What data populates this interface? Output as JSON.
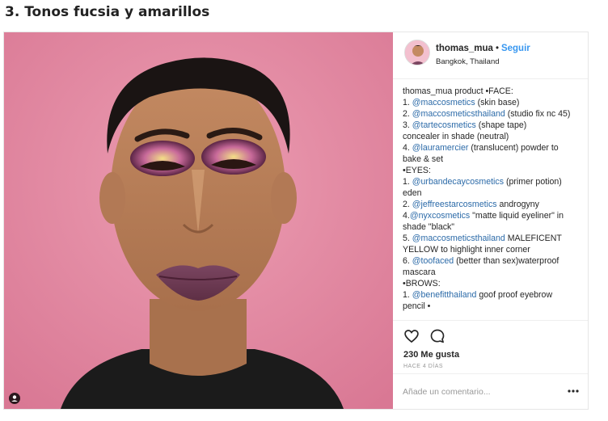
{
  "article": {
    "heading": "3. Tonos fucsia y amarillos"
  },
  "post": {
    "username": "thomas_mua",
    "separator": "•",
    "follow_label": "Seguir",
    "location": "Bangkok, Thailand",
    "caption_lines": [
      [
        {
          "t": "thomas_mua",
          "k": "user"
        },
        {
          "t": " product •FACE:",
          "k": "text"
        }
      ],
      [
        {
          "t": "1. ",
          "k": "text"
        },
        {
          "t": "@maccosmetics",
          "k": "handle"
        },
        {
          "t": " (skin base)",
          "k": "text"
        }
      ],
      [
        {
          "t": "2. ",
          "k": "text"
        },
        {
          "t": "@maccosmeticsthailand",
          "k": "handle"
        },
        {
          "t": " (studio fix nc 45)",
          "k": "text"
        }
      ],
      [
        {
          "t": "3. ",
          "k": "text"
        },
        {
          "t": "@tartecosmetics",
          "k": "handle"
        },
        {
          "t": " (shape tape)",
          "k": "text"
        }
      ],
      [
        {
          "t": "concealer in shade (neutral)",
          "k": "text"
        }
      ],
      [
        {
          "t": "4. ",
          "k": "text"
        },
        {
          "t": "@lauramercier",
          "k": "handle"
        },
        {
          "t": " (translucent) powder to",
          "k": "text"
        }
      ],
      [
        {
          "t": "bake & set",
          "k": "text"
        }
      ],
      [
        {
          "t": "•EYES:",
          "k": "text"
        }
      ],
      [
        {
          "t": "1. ",
          "k": "text"
        },
        {
          "t": "@urbandecaycosmetics",
          "k": "handle"
        },
        {
          "t": " (primer potion)",
          "k": "text"
        }
      ],
      [
        {
          "t": "eden",
          "k": "text"
        }
      ],
      [
        {
          "t": "2. ",
          "k": "text"
        },
        {
          "t": "@jeffreestarcosmetics",
          "k": "handle"
        },
        {
          "t": " androgyny",
          "k": "text"
        }
      ],
      [
        {
          "t": "4.",
          "k": "text"
        },
        {
          "t": "@nyxcosmetics",
          "k": "handle"
        },
        {
          "t": " \"matte liquid eyeliner\" in",
          "k": "text"
        }
      ],
      [
        {
          "t": "shade \"black\"",
          "k": "text"
        }
      ],
      [
        {
          "t": "5. ",
          "k": "text"
        },
        {
          "t": "@maccosmeticsthailand",
          "k": "handle"
        },
        {
          "t": " MALEFICENT",
          "k": "text"
        }
      ],
      [
        {
          "t": "YELLOW to highlight inner corner",
          "k": "text"
        }
      ],
      [
        {
          "t": "6. ",
          "k": "text"
        },
        {
          "t": "@toofaced",
          "k": "handle"
        },
        {
          "t": " (better than sex)waterproof",
          "k": "text"
        }
      ],
      [
        {
          "t": "mascara",
          "k": "text"
        }
      ],
      [
        {
          "t": "•BROWS:",
          "k": "text"
        }
      ],
      [
        {
          "t": "1. ",
          "k": "text"
        },
        {
          "t": "@benefitthailand",
          "k": "handle"
        },
        {
          "t": " goof proof eyebrow",
          "k": "text"
        }
      ],
      [
        {
          "t": "pencil •",
          "k": "text"
        }
      ]
    ],
    "likes": "230 Me gusta",
    "time_ago": "HACE 4 DÍAS",
    "comment_placeholder": "Añade un comentario...",
    "icons": {
      "like": "heart-icon",
      "comment": "comment-icon",
      "more": "more-options-icon",
      "tag": "user-tag-icon"
    }
  },
  "colors": {
    "link_blue": "#3897f0",
    "handle_blue": "#2b6aa8",
    "background_pink": "#e48aa2",
    "lip_plum": "#6e3b52"
  }
}
